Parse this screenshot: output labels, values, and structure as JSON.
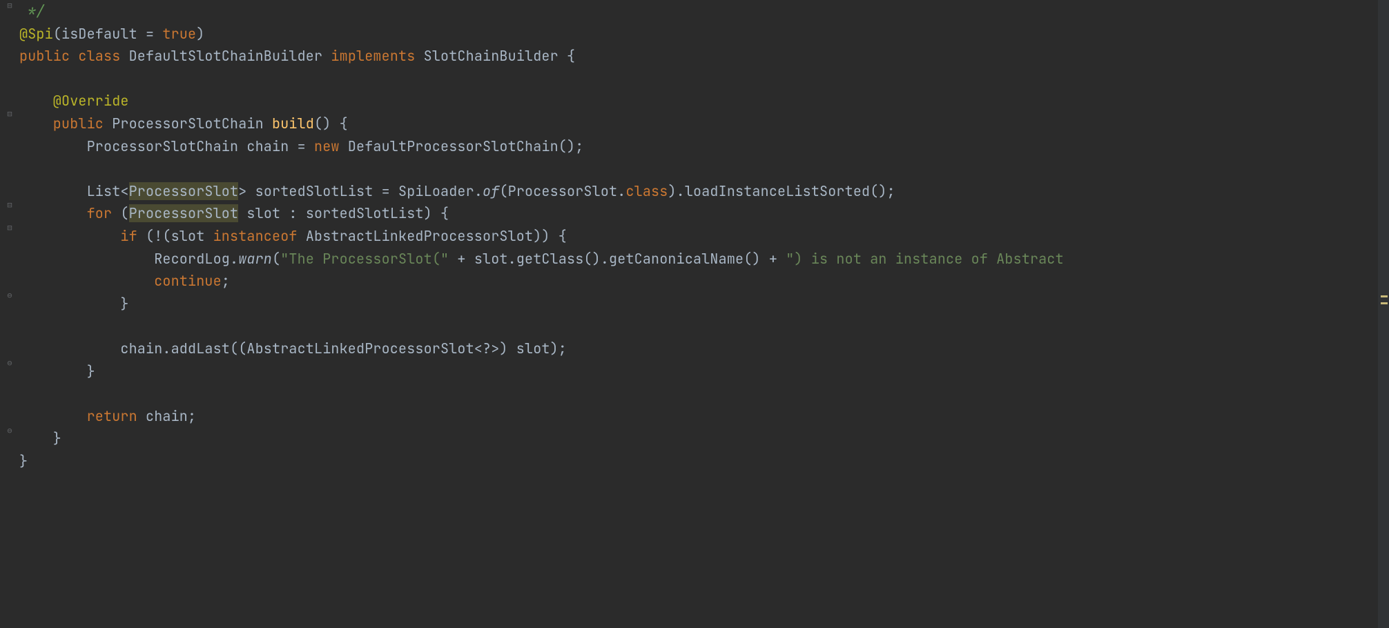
{
  "code": {
    "l1_comment": " */",
    "l2_annot": "@Spi",
    "l2_p1": "(isDefault = ",
    "l2_true": "true",
    "l2_p2": ")",
    "l3_kw1": "public class ",
    "l3_name": "DefaultSlotChainBuilder ",
    "l3_kw2": "implements ",
    "l3_iface": "SlotChainBuilder {",
    "l5_annot": "    @Override",
    "l6_kw": "    public ",
    "l6_ret": "ProcessorSlotChain ",
    "l6_m": "build",
    "l6_p": "() {",
    "l7_a": "        ProcessorSlotChain chain = ",
    "l7_new": "new ",
    "l7_b": "DefaultProcessorSlotChain();",
    "l9_a": "        List<",
    "l9_hl": "ProcessorSlot",
    "l9_b": "> sortedSlotList = SpiLoader.",
    "l9_of": "of",
    "l9_c": "(ProcessorSlot.",
    "l9_class": "class",
    "l9_d": ").loadInstanceListSorted();",
    "l10_for": "        for ",
    "l10_a": "(",
    "l10_hl": "ProcessorSlot",
    "l10_b": " slot : sortedSlotList) {",
    "l11_if": "            if ",
    "l11_a": "(!(slot ",
    "l11_inst": "instanceof ",
    "l11_b": "AbstractLinkedProcessorSlot)) {",
    "l12_a": "                RecordLog.",
    "l12_warn": "warn",
    "l12_b": "(",
    "l12_s1": "\"The ProcessorSlot(\"",
    "l12_c": " + slot.getClass().getCanonicalName() + ",
    "l12_s2": "\") is not an instance of Abstract",
    "l13_cont": "                continue",
    "l13_semi": ";",
    "l14_brace": "            }",
    "l16": "            chain.addLast((AbstractLinkedProcessorSlot<?>) slot);",
    "l17_brace": "        }",
    "l19_ret": "        return ",
    "l19_b": "chain;",
    "l20_brace": "    }",
    "l21_brace": "}"
  },
  "folds": {
    "f1": "⊟",
    "f2": "⊟",
    "f3": "⊟",
    "f4": "⊟",
    "f5": "⊟",
    "e1": "⊖",
    "e2": "⊖",
    "e3": "⊖",
    "e4": "⊖"
  }
}
